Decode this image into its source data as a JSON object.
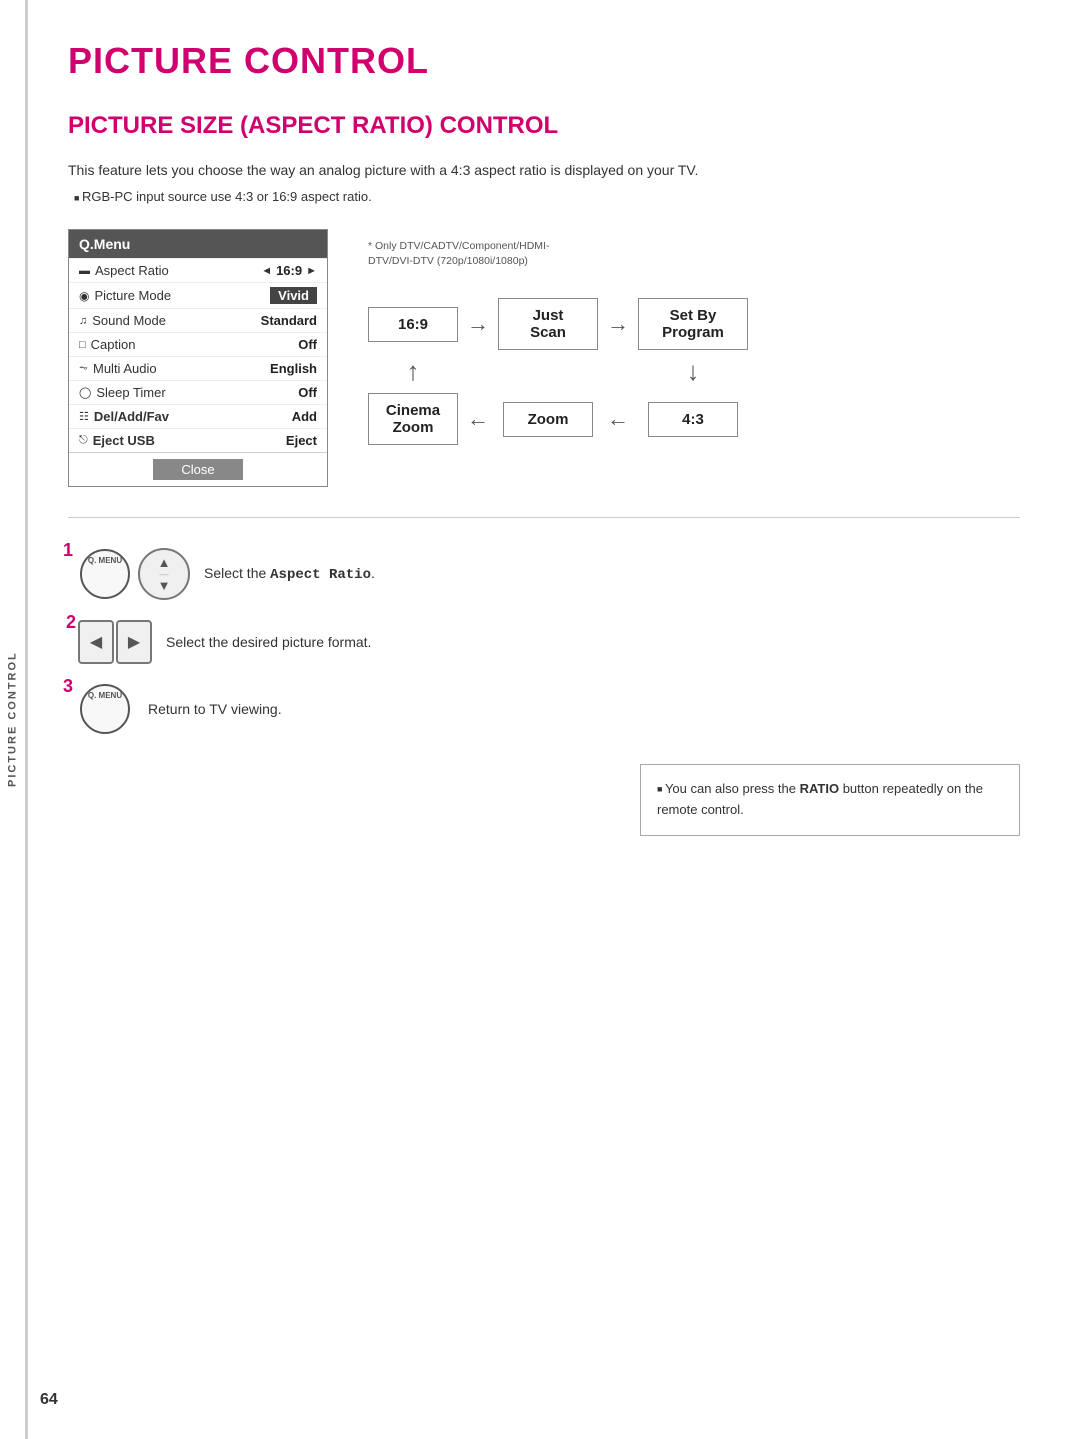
{
  "page": {
    "title": "PICTURE CONTROL",
    "section_title": "PICTURE SIZE (ASPECT RATIO) CONTROL",
    "intro_text": "This feature lets you choose the way an analog picture with a 4:3 aspect ratio is displayed on your TV.",
    "intro_bullet": "RGB-PC input source use 4:3 or 16:9 aspect ratio.",
    "page_number": "64",
    "side_tab": "PICTURE CONTROL"
  },
  "qmenu": {
    "header": "Q.Menu",
    "rows": [
      {
        "label": "Aspect Ratio",
        "value": "16:9",
        "highlight": false,
        "has_arrows": true
      },
      {
        "label": "Picture Mode",
        "value": "Vivid",
        "highlight": true
      },
      {
        "label": "Sound Mode",
        "value": "Standard",
        "highlight": false
      },
      {
        "label": "Caption",
        "value": "Off",
        "highlight": false
      },
      {
        "label": "Multi Audio",
        "value": "English",
        "highlight": false
      },
      {
        "label": "Sleep Timer",
        "value": "Off",
        "highlight": false
      },
      {
        "label": "Del/Add/Fav",
        "value": "Add",
        "highlight": false
      },
      {
        "label": "Eject USB",
        "value": "Eject",
        "highlight": false
      }
    ],
    "close_label": "Close"
  },
  "flow": {
    "note_line1": "* Only DTV/CADTV/Component/HDMI-",
    "note_line2": "DTV/DVI-DTV (720p/1080i/1080p)",
    "boxes": {
      "b_16_9": "16:9",
      "b_just_scan": "Just Scan",
      "b_set_by": "Set By  Program",
      "b_cinema_zoom": "Cinema Zoom",
      "b_zoom": "Zoom",
      "b_4_3": "4:3"
    }
  },
  "steps": [
    {
      "number": "1",
      "text": "Select the ",
      "text_bold": "Aspect Ratio",
      "text_after": ".",
      "has_qmenu_btn": true,
      "has_nav_wheel": true
    },
    {
      "number": "2",
      "text": "Select the desired picture format.",
      "has_lr_arrows": true
    },
    {
      "number": "3",
      "text": "Return to TV viewing.",
      "has_qmenu_btn": true
    }
  ],
  "tip": {
    "text": "You can also press the ",
    "text_bold": "RATIO",
    "text_after": " button repeatedly on the remote control."
  }
}
